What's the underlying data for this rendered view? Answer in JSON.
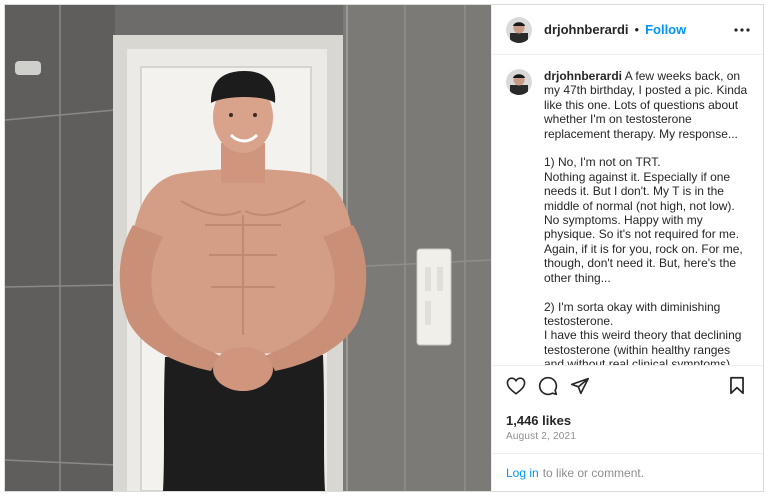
{
  "post": {
    "username": "drjohnberardi",
    "separator": "•",
    "follow_label": "Follow",
    "more_icon": "more-horizontal-icon",
    "caption": "A few weeks back, on my 47th birthday, I posted a pic. Kinda like this one. Lots of questions about whether I'm on testosterone replacement therapy. My response...\n\n1) No, I'm not on TRT.\nNothing against it. Especially if one needs it. But I don't. My T is in the middle of normal (not high, not low). No symptoms. Happy with my physique. So it's not required for me. Again, if it is for you, rock on. For me, though, don't need it. But, here's the other thing...\n\n2) I'm sorta okay with diminishing testosterone.\nI have this weird theory that declining testosterone (within healthy ranges and without real clinical symptoms) can help men of",
    "likes": "1,446 likes",
    "date": "August 2, 2021"
  },
  "actions": {
    "like_icon": "heart-icon",
    "comment_icon": "comment-icon",
    "share_icon": "share-icon",
    "save_icon": "bookmark-icon"
  },
  "footer": {
    "login_label": "Log in",
    "prompt": "to like or comment."
  },
  "colors": {
    "link": "#0095f6",
    "text": "#262626",
    "muted": "#8e8e8e",
    "border": "#dbdbdb"
  }
}
